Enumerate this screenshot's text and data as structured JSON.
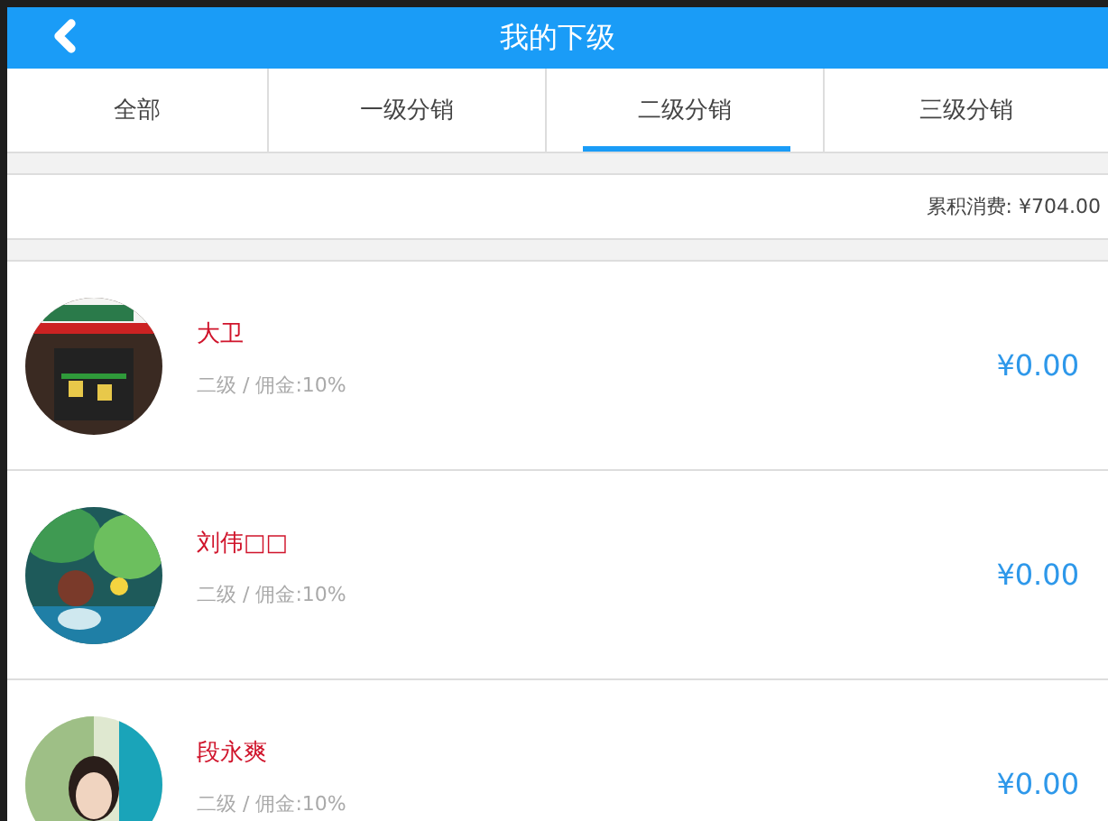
{
  "header": {
    "title": "我的下级"
  },
  "tabs": [
    {
      "label": "全部",
      "selected": false
    },
    {
      "label": "一级分销",
      "selected": false
    },
    {
      "label": "二级分销",
      "selected": true
    },
    {
      "label": "三级分销",
      "selected": false
    }
  ],
  "summary": {
    "text": "累积消费: ¥704.00"
  },
  "members": [
    {
      "name": "大卫",
      "info": "二级 / 佣金:10%",
      "amount": "¥0.00"
    },
    {
      "name": "刘伟□□",
      "info": "二级 / 佣金:10%",
      "amount": "¥0.00"
    },
    {
      "name": "段永爽",
      "info": "二级 / 佣金:10%",
      "amount": "¥0.00"
    }
  ]
}
